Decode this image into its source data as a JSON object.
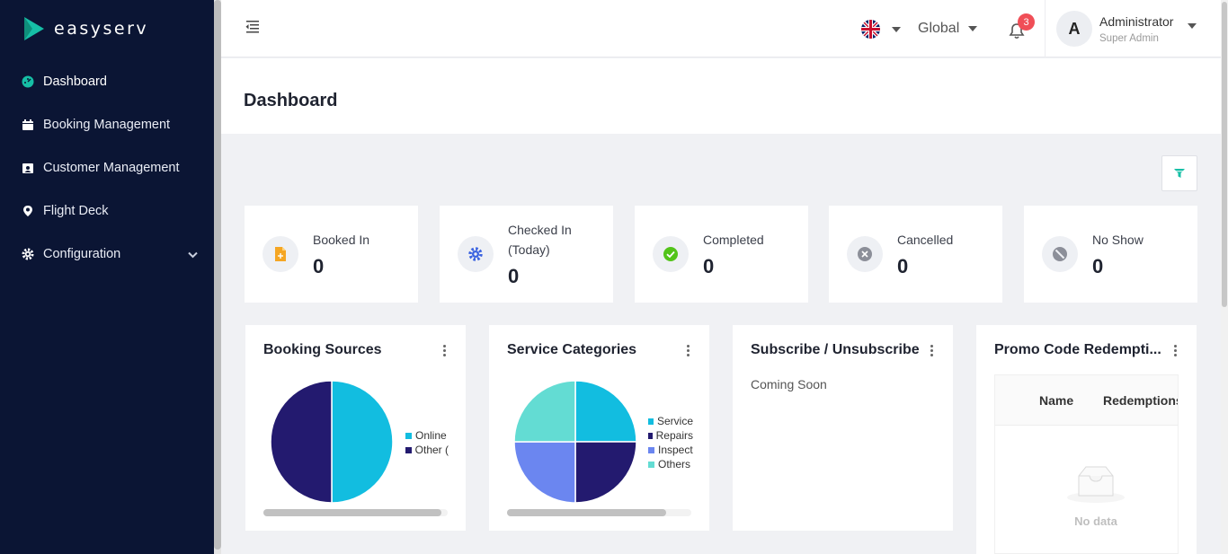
{
  "brand": {
    "name": "easyserv"
  },
  "sidebar": {
    "items": [
      {
        "label": "Dashboard",
        "icon": "dashboard-icon"
      },
      {
        "label": "Booking Management",
        "icon": "calendar-icon"
      },
      {
        "label": "Customer Management",
        "icon": "contact-card-icon"
      },
      {
        "label": "Flight Deck",
        "icon": "location-pin-icon"
      },
      {
        "label": "Configuration",
        "icon": "gear-icon"
      }
    ]
  },
  "topbar": {
    "language": "en-GB",
    "region": "Global",
    "notifications_count": "3",
    "user": {
      "initial": "A",
      "name": "Administrator",
      "role": "Super Admin"
    }
  },
  "page": {
    "title": "Dashboard"
  },
  "stats": [
    {
      "label": "Booked In",
      "value": "0",
      "color": "#f5a623",
      "icon": "file-plus-icon"
    },
    {
      "label": "Checked In (Today)",
      "value": "0",
      "color": "#3b63e0",
      "icon": "gear-icon"
    },
    {
      "label": "Completed",
      "value": "0",
      "color": "#52c41a",
      "icon": "check-circle-icon"
    },
    {
      "label": "Cancelled",
      "value": "0",
      "color": "#8c8f99",
      "icon": "close-circle-icon"
    },
    {
      "label": "No Show",
      "value": "0",
      "color": "#8c8f99",
      "icon": "ban-icon"
    }
  ],
  "panels": {
    "booking_sources": {
      "title": "Booking Sources"
    },
    "service_categories": {
      "title": "Service Categories"
    },
    "subscribe": {
      "title": "Subscribe / Unsubscribe",
      "text": "Coming Soon"
    },
    "promo": {
      "title": "Promo Code Redempti...",
      "columns": [
        "Name",
        "Redemptions"
      ],
      "empty_text": "No data"
    }
  },
  "colors": {
    "accent": "#16bfa6",
    "sidebar_bg": "#0b1534"
  },
  "chart_data": [
    {
      "type": "pie",
      "labels": [
        "Online",
        "Other ("
      ],
      "values": [
        50,
        50
      ],
      "colors": [
        "#12bde0",
        "#231a6f"
      ]
    },
    {
      "type": "pie",
      "labels": [
        "Service",
        "Repairs",
        "Inspect",
        "Others"
      ],
      "values": [
        25,
        25,
        25,
        25
      ],
      "colors": [
        "#12bde0",
        "#231a6f",
        "#6b86f0",
        "#63dcd3"
      ]
    }
  ]
}
